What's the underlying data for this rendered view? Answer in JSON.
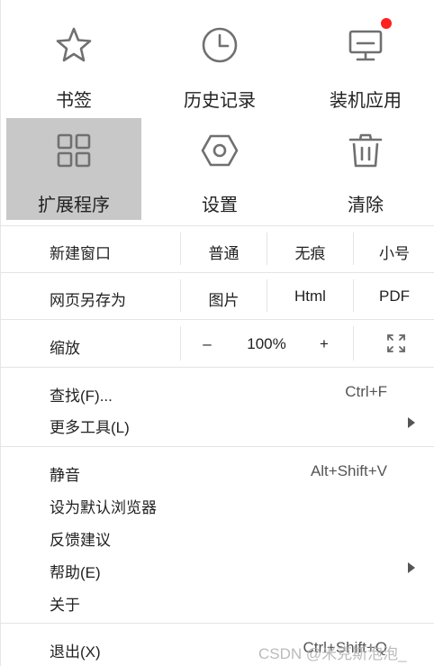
{
  "icons_row1": [
    {
      "label": "书签",
      "icon": "star-icon"
    },
    {
      "label": "历史记录",
      "icon": "clock-icon"
    },
    {
      "label": "装机应用",
      "icon": "monitor-icon"
    }
  ],
  "icons_row2": [
    {
      "label": "扩展程序",
      "icon": "extensions-grid-icon"
    },
    {
      "label": "设置",
      "icon": "hexagon-gear-icon"
    },
    {
      "label": "清除",
      "icon": "trash-icon"
    }
  ],
  "new_window": {
    "label": "新建窗口",
    "options": [
      "普通",
      "无痕",
      "小号"
    ]
  },
  "save_page": {
    "label": "网页另存为",
    "options": [
      "图片",
      "Html",
      "PDF"
    ]
  },
  "zoom": {
    "label": "缩放",
    "minus": "–",
    "value": "100%",
    "plus": "+",
    "fullscreen_icon": "fullscreen-icon"
  },
  "menu_group1": [
    {
      "label": "查找(F)...",
      "shortcut": "Ctrl+F"
    },
    {
      "label": "更多工具(L)",
      "submenu": true
    }
  ],
  "menu_group2": [
    {
      "label": "静音",
      "shortcut": "Alt+Shift+V"
    },
    {
      "label": "设为默认浏览器"
    },
    {
      "label": "反馈建议"
    },
    {
      "label": "帮助(E)",
      "submenu": true
    },
    {
      "label": "关于"
    }
  ],
  "exit": {
    "label": "退出(X)",
    "shortcut": "Ctrl+Shift+Q"
  },
  "watermark": "CSDN @米克斯泡泡_",
  "colors": {
    "selected_tile": "#c8c8c8",
    "notification_dot": "#ff1f1f",
    "icon_gray": "#707070"
  }
}
